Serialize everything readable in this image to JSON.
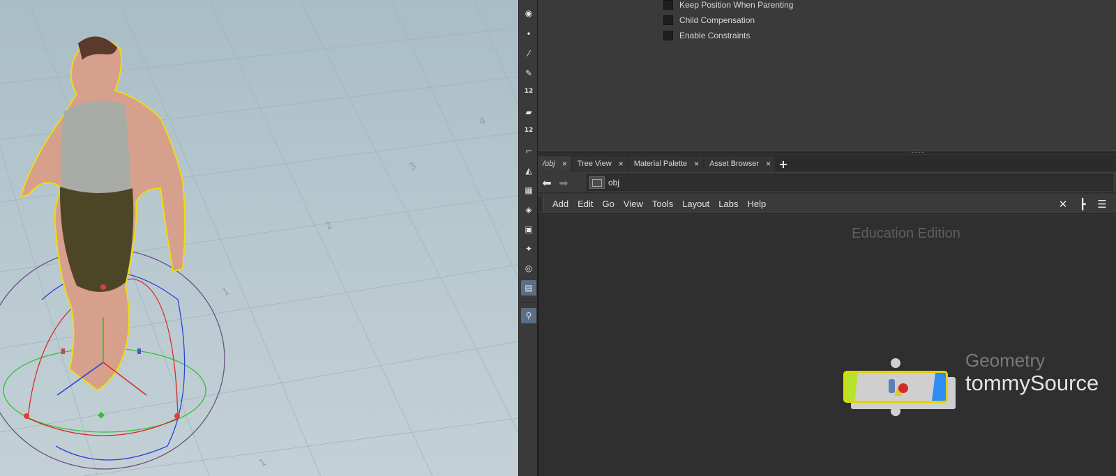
{
  "parameters": {
    "checkboxes": [
      {
        "label": "Keep Position When Parenting",
        "checked": false
      },
      {
        "label": "Child Compensation",
        "checked": false
      },
      {
        "label": "Enable Constraints",
        "checked": false
      }
    ]
  },
  "tabs": [
    {
      "label": "/obj",
      "active": true
    },
    {
      "label": "Tree View",
      "active": false
    },
    {
      "label": "Material Palette",
      "active": false
    },
    {
      "label": "Asset Browser",
      "active": false
    }
  ],
  "tab_close_glyph": "×",
  "tab_add_glyph": "+",
  "path_bar": {
    "path": "obj"
  },
  "menu": [
    "Add",
    "Edit",
    "Go",
    "View",
    "Tools",
    "Layout",
    "Labs",
    "Help"
  ],
  "network": {
    "watermark": "Education Edition",
    "node": {
      "type": "Geometry",
      "name": "tommySource",
      "color_left": "#b7e32a",
      "color_right": "#2f8cf5",
      "selected_outline": "#e2d400"
    }
  },
  "shelf": {
    "tools": [
      "view-icon",
      "point-icon",
      "edge-icon",
      "brush-icon",
      "number-display-icon",
      "paint-icon",
      "number-display-icon",
      "curve-icon",
      "pen-icon",
      "checker-icon",
      "plane-icon",
      "frame-icon",
      "light-icon",
      "circle-icon",
      "image-icon",
      "pin-icon"
    ],
    "labels": {
      "num1": "12",
      "num2": "12"
    }
  },
  "icons": {
    "back": "back-arrow-icon",
    "forward": "forward-arrow-icon",
    "toolbar": [
      "wrench-icon",
      "tree-icon",
      "list-icon"
    ]
  }
}
